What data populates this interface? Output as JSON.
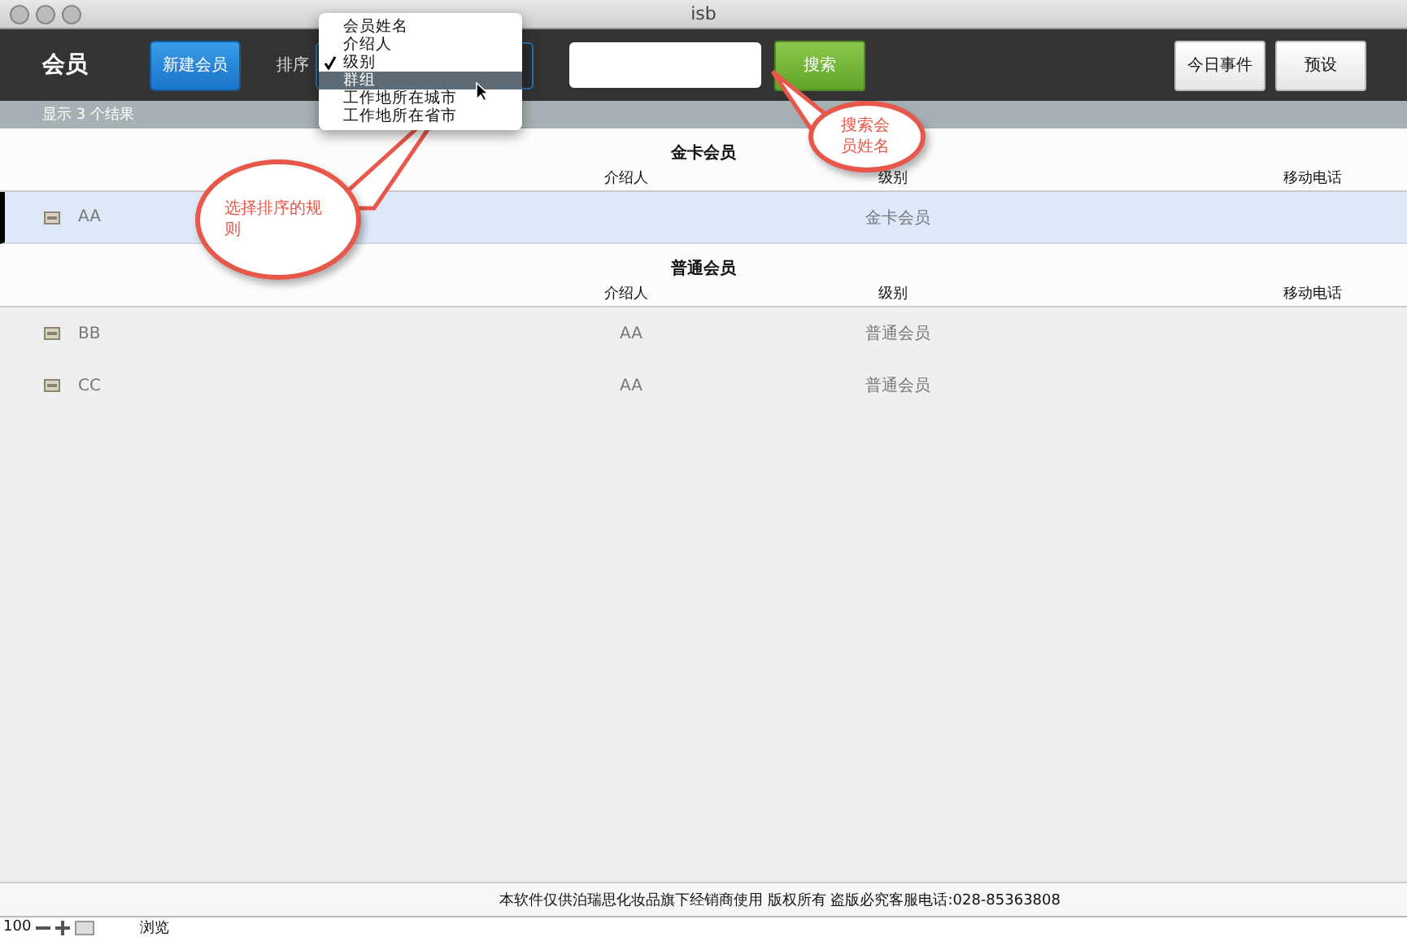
{
  "window": {
    "title": "isb"
  },
  "toolbar": {
    "title": "会员",
    "new_button": "新建会员",
    "sort_label": "排序",
    "search_button": "搜索",
    "buttons": [
      "今日事件",
      "预设"
    ]
  },
  "sort_menu": [
    {
      "label": "会员姓名",
      "checked": false,
      "highlighted": false
    },
    {
      "label": "介绍人",
      "checked": false,
      "highlighted": false
    },
    {
      "label": "级别",
      "checked": true,
      "highlighted": false
    },
    {
      "label": "群组",
      "checked": false,
      "highlighted": true
    },
    {
      "label": "工作地所在城市",
      "checked": false,
      "highlighted": false
    },
    {
      "label": "工作地所在省市",
      "checked": false,
      "highlighted": false
    }
  ],
  "results_count": "显示 3 个结果",
  "groups": [
    {
      "title": "金卡会员",
      "columns": [
        "介绍人",
        "级别",
        "移动电话"
      ],
      "rows": [
        {
          "name": "AA",
          "level": "金卡会员",
          "selected": true
        }
      ]
    },
    {
      "title": "普通会员",
      "columns": [
        "介绍人",
        "级别",
        "移动电话"
      ],
      "rows": [
        {
          "name": "BB",
          "referrer": "AA",
          "level": "普通会员",
          "selected": false
        },
        {
          "name": "CC",
          "referrer": "AA",
          "level": "普通会员",
          "selected": false
        }
      ]
    }
  ],
  "callouts": [
    {
      "kind": "sort",
      "text": "选择排序的规则"
    },
    {
      "kind": "search",
      "text": "搜索会员姓名"
    }
  ],
  "footer": "本软件仅供泊瑞思化妆品旗下经销商使用 版权所有 盗版必究客服电话:028-85363808",
  "status_bar": {
    "zoom": "100",
    "mode": "浏览"
  }
}
